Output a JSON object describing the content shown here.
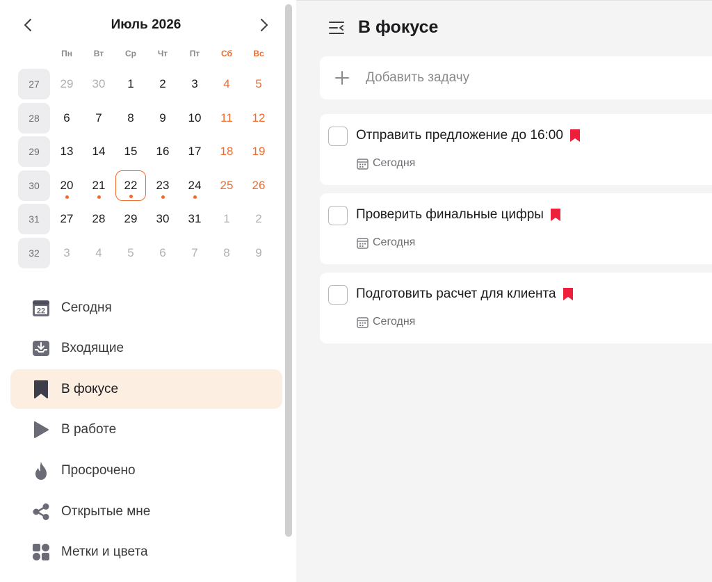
{
  "calendar": {
    "month_title": "Июль 2026",
    "weekdays": [
      "Пн",
      "Вт",
      "Ср",
      "Чт",
      "Пт",
      "Сб",
      "Вс"
    ],
    "weeks": [
      {
        "num": "27",
        "days": [
          {
            "d": "29",
            "muted": true
          },
          {
            "d": "30",
            "muted": true
          },
          {
            "d": "1"
          },
          {
            "d": "2"
          },
          {
            "d": "3"
          },
          {
            "d": "4",
            "weekend": true
          },
          {
            "d": "5",
            "weekend": true
          }
        ]
      },
      {
        "num": "28",
        "days": [
          {
            "d": "6"
          },
          {
            "d": "7"
          },
          {
            "d": "8"
          },
          {
            "d": "9"
          },
          {
            "d": "10"
          },
          {
            "d": "11",
            "weekend": true
          },
          {
            "d": "12",
            "weekend": true
          }
        ]
      },
      {
        "num": "29",
        "days": [
          {
            "d": "13"
          },
          {
            "d": "14"
          },
          {
            "d": "15"
          },
          {
            "d": "16"
          },
          {
            "d": "17"
          },
          {
            "d": "18",
            "weekend": true
          },
          {
            "d": "19",
            "weekend": true
          }
        ]
      },
      {
        "num": "30",
        "days": [
          {
            "d": "20",
            "dot": true
          },
          {
            "d": "21",
            "dot": true
          },
          {
            "d": "22",
            "dot": true,
            "today": true
          },
          {
            "d": "23",
            "dot": true
          },
          {
            "d": "24",
            "dot": true
          },
          {
            "d": "25",
            "weekend": true
          },
          {
            "d": "26",
            "weekend": true
          }
        ]
      },
      {
        "num": "31",
        "days": [
          {
            "d": "27"
          },
          {
            "d": "28"
          },
          {
            "d": "29"
          },
          {
            "d": "30"
          },
          {
            "d": "31"
          },
          {
            "d": "1",
            "muted": true,
            "weekend": true
          },
          {
            "d": "2",
            "muted": true,
            "weekend": true
          }
        ]
      },
      {
        "num": "32",
        "days": [
          {
            "d": "3",
            "muted": true
          },
          {
            "d": "4",
            "muted": true
          },
          {
            "d": "5",
            "muted": true
          },
          {
            "d": "6",
            "muted": true
          },
          {
            "d": "7",
            "muted": true
          },
          {
            "d": "8",
            "muted": true,
            "weekend": true
          },
          {
            "d": "9",
            "muted": true,
            "weekend": true
          }
        ]
      }
    ]
  },
  "nav": {
    "items": [
      {
        "label": "Сегодня",
        "icon": "calendar-day-icon",
        "badge": "22"
      },
      {
        "label": "Входящие",
        "icon": "inbox-icon"
      },
      {
        "label": "В фокусе",
        "icon": "bookmark-icon",
        "active": true
      },
      {
        "label": "В работе",
        "icon": "play-icon"
      },
      {
        "label": "Просрочено",
        "icon": "flame-icon"
      },
      {
        "label": "Открытые мне",
        "icon": "share-icon"
      },
      {
        "label": "Метки и цвета",
        "icon": "tags-grid-icon"
      }
    ]
  },
  "main": {
    "title": "В фокусе",
    "add_task_placeholder": "Добавить задачу",
    "tasks": [
      {
        "title": "Отправить предложение до 16:00",
        "due": "Сегодня"
      },
      {
        "title": "Проверить финальные цифры",
        "due": "Сегодня"
      },
      {
        "title": "Подготовить расчет для клиента",
        "due": "Сегодня"
      }
    ]
  },
  "colors": {
    "accent": "#f26a2a",
    "flag": "#ee1f3b",
    "active_bg": "#fdeee2",
    "icon_gray": "#6b6b78"
  }
}
